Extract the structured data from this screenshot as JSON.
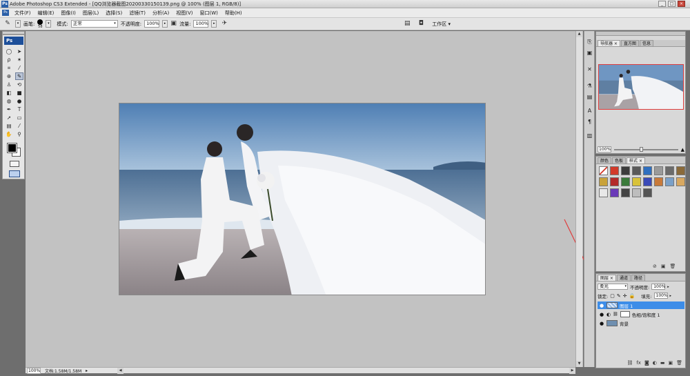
{
  "titlebar": {
    "title": "Adobe Photoshop CS3 Extended - [QQ浏览器截图20200330150139.png @ 100% (图层 1, RGB/8)]",
    "app_icon": "Ps",
    "minimize_icon": "minimize-icon",
    "maximize_icon": "maximize-icon",
    "close_icon": "close-icon"
  },
  "menu": {
    "items": [
      "文件(F)",
      "编辑(E)",
      "图像(I)",
      "图层(L)",
      "选择(S)",
      "滤镜(T)",
      "分析(A)",
      "视图(V)",
      "窗口(W)",
      "帮助(H)"
    ]
  },
  "options": {
    "brush_label": "画笔:",
    "brush_size": "58",
    "mode_label": "模式:",
    "mode_value": "正常",
    "opacity_label": "不透明度:",
    "opacity_value": "100%",
    "flow_label": "流量:",
    "flow_value": "100%",
    "workspace_label": "工作区 ▾"
  },
  "tools": {
    "badge": "Ps"
  },
  "status": {
    "zoom": "100%",
    "doc": "文档:1.58M/1.58M"
  },
  "navigator": {
    "tabs": [
      "导航器 ×",
      "直方图",
      "信息"
    ],
    "zoom": "100%"
  },
  "styles": {
    "tabs": [
      "颜色",
      "色板",
      "样式 ×"
    ],
    "swatches": [
      "#ffffff",
      "#d23a2a",
      "#3c3c3c",
      "#5a5a5a",
      "#2f6fbf",
      "#9a9a9a",
      "#6b6b6b",
      "#8a6a3a",
      "#c8a23a",
      "#b32a2a",
      "#3a7a3a",
      "#d8c23a",
      "#3a4ab8",
      "#c87a3a",
      "#7aa0c8",
      "#d8a860",
      "#e8e8e8",
      "#6a3ab8",
      "#444444",
      "#bdbdbd",
      "#555555"
    ]
  },
  "layers": {
    "tabs": [
      "图层 ×",
      "通道",
      "路径"
    ],
    "blend_mode": "柔光",
    "opacity_label": "不透明度:",
    "opacity_value": "100%",
    "lock_label": "锁定:",
    "fill_label": "填充:",
    "fill_value": "100%",
    "rows": [
      {
        "name": "图层 1",
        "selected": true
      },
      {
        "name": "色相/饱和度 1",
        "selected": false
      },
      {
        "name": "背景",
        "selected": false
      }
    ]
  },
  "colors": {
    "accent": "#3d8de8",
    "ps_blue": "#1d4f9a",
    "arrow": "#e03c3c"
  }
}
